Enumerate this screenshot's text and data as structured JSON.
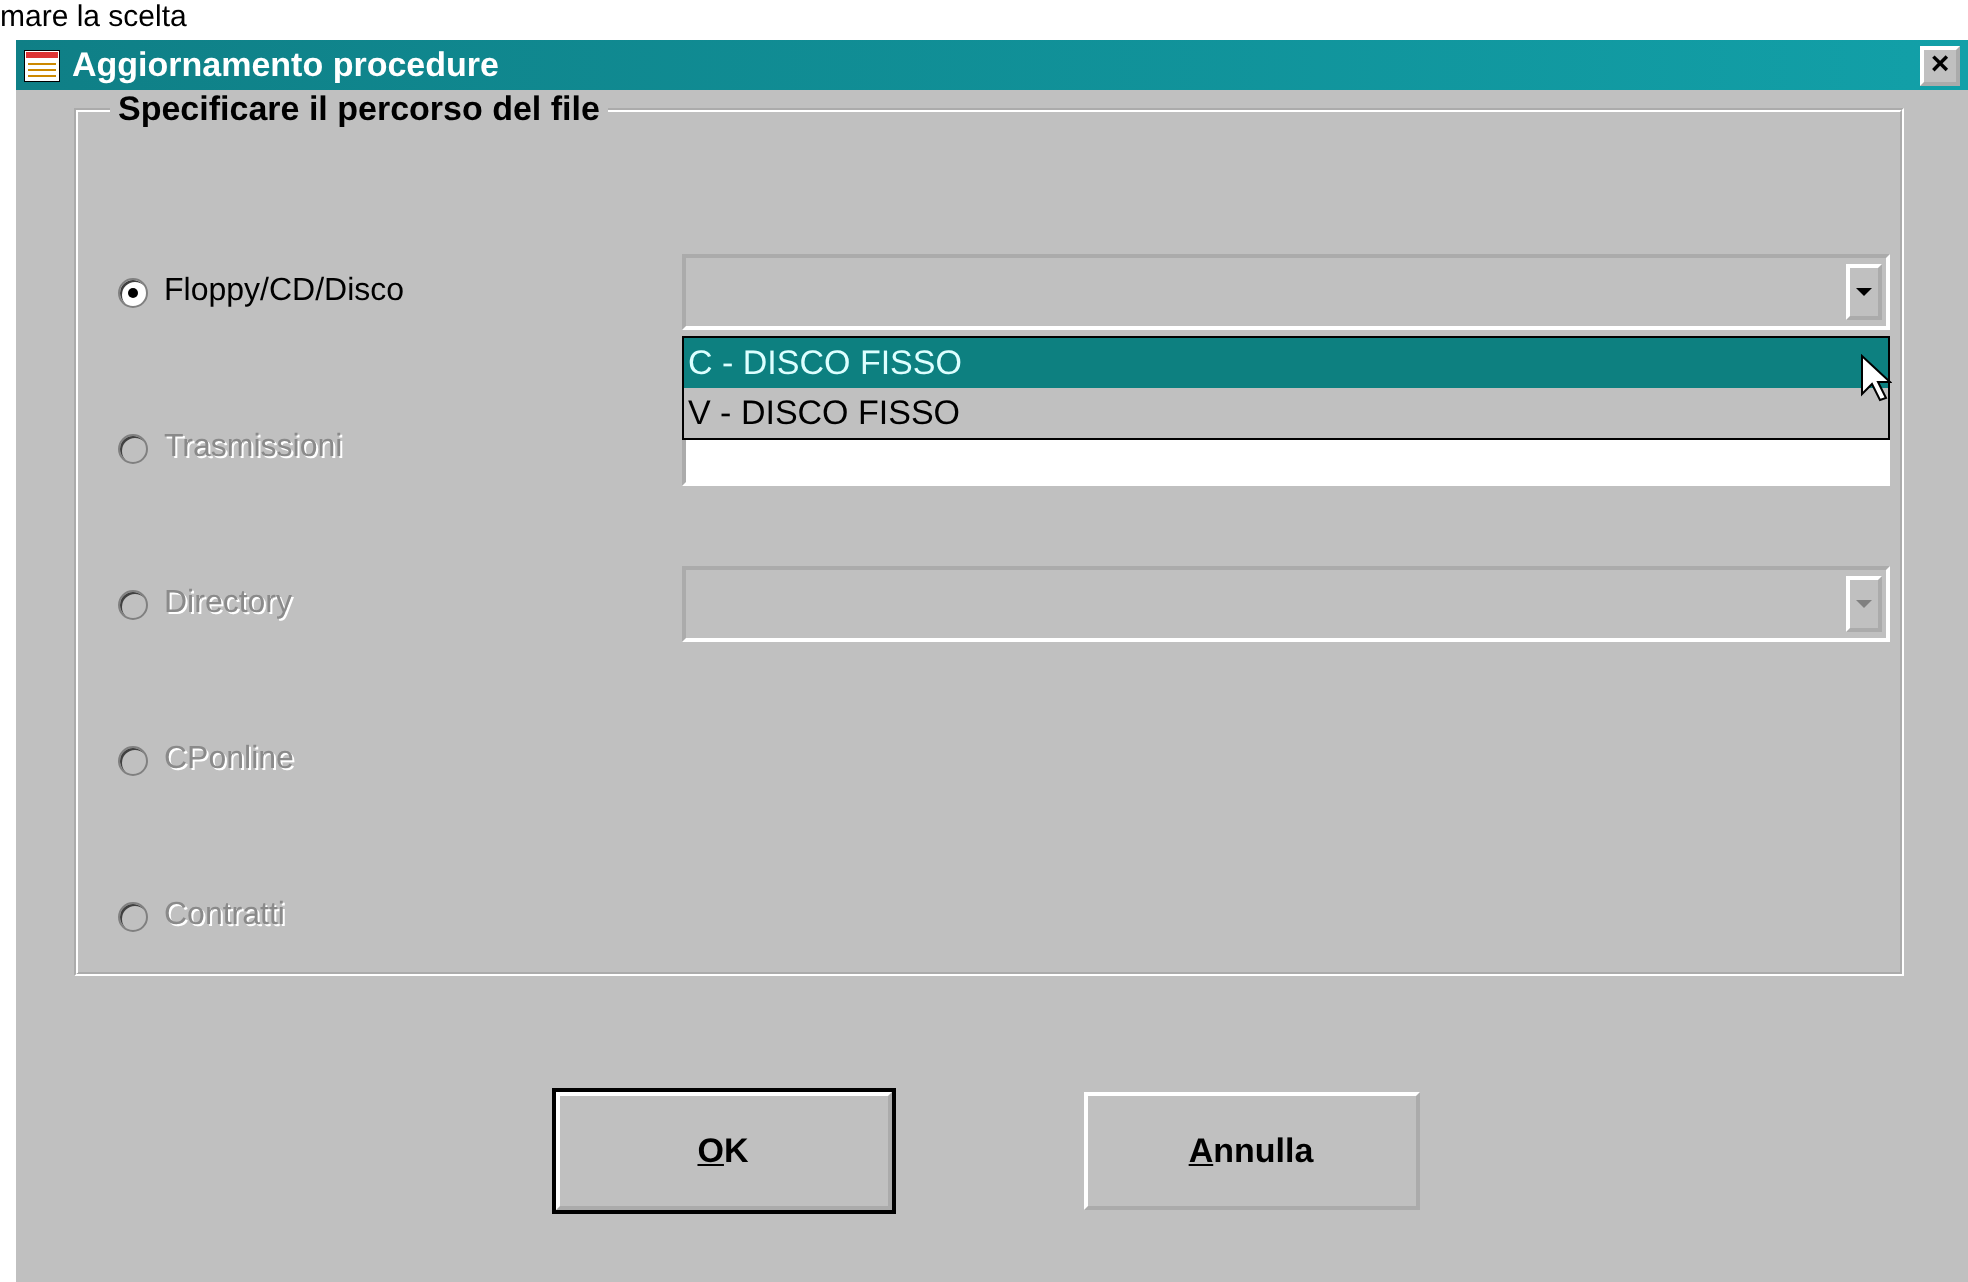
{
  "caption": "mare la scelta",
  "window": {
    "title": "Aggiornamento procedure",
    "close": "×"
  },
  "group": {
    "title": "Specificare il percorso del file",
    "options": [
      {
        "label": "Floppy/CD/Disco",
        "selected": true,
        "disabled": false,
        "field": {
          "kind": "combo",
          "disabled": false,
          "open": true
        }
      },
      {
        "label": "Trasmissioni",
        "selected": false,
        "disabled": true,
        "field": {
          "kind": "text"
        }
      },
      {
        "label": "Directory",
        "selected": false,
        "disabled": true,
        "field": {
          "kind": "combo",
          "disabled": true
        }
      },
      {
        "label": "CPonline",
        "selected": false,
        "disabled": true
      },
      {
        "label": "Contratti",
        "selected": false,
        "disabled": true
      }
    ]
  },
  "dropdown": {
    "items": [
      {
        "label": "C - DISCO FISSO",
        "selected": true
      },
      {
        "label": "V - DISCO FISSO",
        "selected": false
      }
    ]
  },
  "buttons": [
    {
      "label": "OK",
      "default": true
    },
    {
      "label": "Annulla",
      "default": false
    }
  ]
}
